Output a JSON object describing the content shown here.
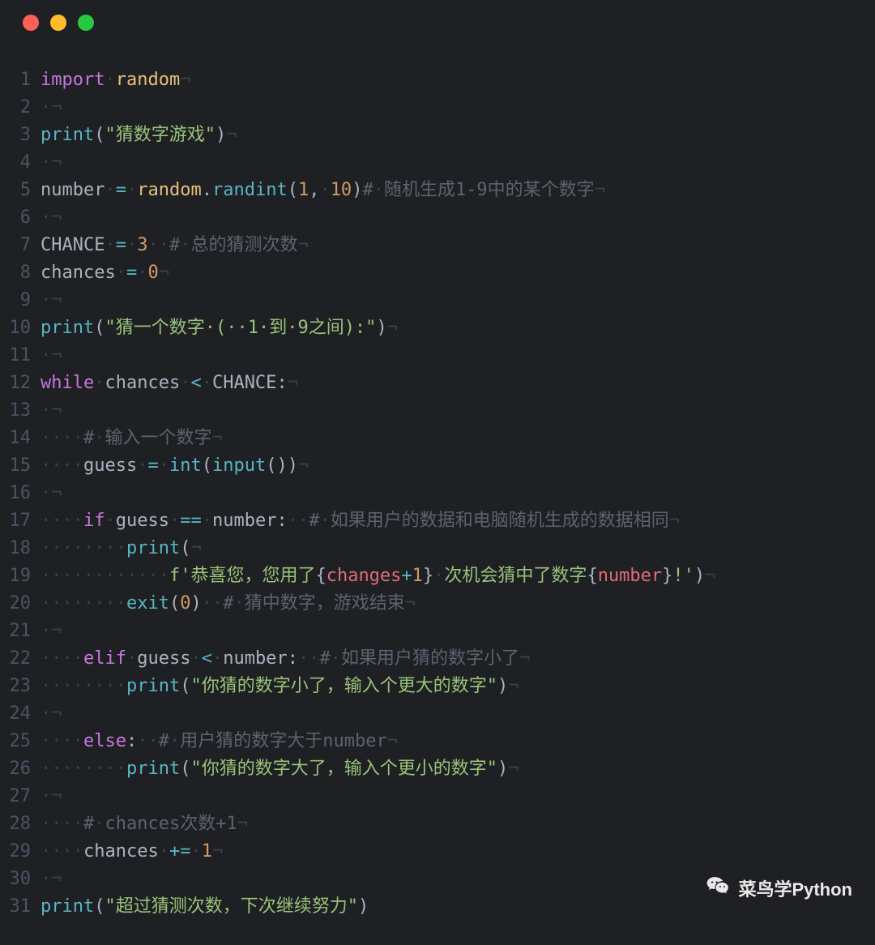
{
  "window": {
    "traffic": [
      "red",
      "yellow",
      "green"
    ]
  },
  "editor": {
    "invisibles": {
      "dot": "·",
      "eol": "¬"
    },
    "lines": [
      {
        "n": 1,
        "tokens": [
          {
            "t": "import",
            "c": "kw"
          },
          {
            "t": "·",
            "c": "ws"
          },
          {
            "t": "random",
            "c": "id"
          },
          {
            "t": "¬",
            "c": "ws"
          }
        ]
      },
      {
        "n": 2,
        "tokens": [
          {
            "t": "·",
            "c": "ws"
          },
          {
            "t": "¬",
            "c": "ws"
          }
        ]
      },
      {
        "n": 3,
        "tokens": [
          {
            "t": "print",
            "c": "fn"
          },
          {
            "t": "(",
            "c": "pn"
          },
          {
            "t": "\"猜数字游戏\"",
            "c": "str"
          },
          {
            "t": ")",
            "c": "pn"
          },
          {
            "t": "¬",
            "c": "ws"
          }
        ]
      },
      {
        "n": 4,
        "tokens": [
          {
            "t": "·",
            "c": "ws"
          },
          {
            "t": "¬",
            "c": "ws"
          }
        ]
      },
      {
        "n": 5,
        "tokens": [
          {
            "t": "number",
            "c": "var"
          },
          {
            "t": "·",
            "c": "ws"
          },
          {
            "t": "=",
            "c": "op"
          },
          {
            "t": "·",
            "c": "ws"
          },
          {
            "t": "random",
            "c": "id"
          },
          {
            "t": ".",
            "c": "pn"
          },
          {
            "t": "randint",
            "c": "fn"
          },
          {
            "t": "(",
            "c": "pn"
          },
          {
            "t": "1",
            "c": "num"
          },
          {
            "t": ",",
            "c": "pn"
          },
          {
            "t": "·",
            "c": "ws"
          },
          {
            "t": "10",
            "c": "num"
          },
          {
            "t": ")",
            "c": "pn"
          },
          {
            "t": "#",
            "c": "cmt"
          },
          {
            "t": "·",
            "c": "ws"
          },
          {
            "t": "随机生成1-9中的某个数字",
            "c": "cmt"
          },
          {
            "t": "¬",
            "c": "ws"
          }
        ]
      },
      {
        "n": 6,
        "tokens": [
          {
            "t": "·",
            "c": "ws"
          },
          {
            "t": "¬",
            "c": "ws"
          }
        ]
      },
      {
        "n": 7,
        "tokens": [
          {
            "t": "CHANCE",
            "c": "var"
          },
          {
            "t": "·",
            "c": "ws"
          },
          {
            "t": "=",
            "c": "op"
          },
          {
            "t": "·",
            "c": "ws"
          },
          {
            "t": "3",
            "c": "num"
          },
          {
            "t": "··",
            "c": "ws"
          },
          {
            "t": "#",
            "c": "cmt"
          },
          {
            "t": "·",
            "c": "ws"
          },
          {
            "t": "总的猜测次数",
            "c": "cmt"
          },
          {
            "t": "¬",
            "c": "ws"
          }
        ]
      },
      {
        "n": 8,
        "tokens": [
          {
            "t": "chances",
            "c": "var"
          },
          {
            "t": "·",
            "c": "ws"
          },
          {
            "t": "=",
            "c": "op"
          },
          {
            "t": "·",
            "c": "ws"
          },
          {
            "t": "0",
            "c": "num"
          },
          {
            "t": "¬",
            "c": "ws"
          }
        ]
      },
      {
        "n": 9,
        "tokens": [
          {
            "t": "·",
            "c": "ws"
          },
          {
            "t": "¬",
            "c": "ws"
          }
        ]
      },
      {
        "n": 10,
        "tokens": [
          {
            "t": "print",
            "c": "fn"
          },
          {
            "t": "(",
            "c": "pn"
          },
          {
            "t": "\"猜一个数字·(··1·到·9之间):\"",
            "c": "str"
          },
          {
            "t": ")",
            "c": "pn"
          },
          {
            "t": "¬",
            "c": "ws"
          }
        ]
      },
      {
        "n": 11,
        "tokens": [
          {
            "t": "·",
            "c": "ws"
          },
          {
            "t": "¬",
            "c": "ws"
          }
        ]
      },
      {
        "n": 12,
        "tokens": [
          {
            "t": "while",
            "c": "kw"
          },
          {
            "t": "·",
            "c": "ws"
          },
          {
            "t": "chances",
            "c": "var"
          },
          {
            "t": "·",
            "c": "ws"
          },
          {
            "t": "<",
            "c": "op"
          },
          {
            "t": "·",
            "c": "ws"
          },
          {
            "t": "CHANCE",
            "c": "var"
          },
          {
            "t": ":",
            "c": "pn"
          },
          {
            "t": "¬",
            "c": "ws"
          }
        ]
      },
      {
        "n": 13,
        "tokens": [
          {
            "t": "·",
            "c": "ws"
          },
          {
            "t": "¬",
            "c": "ws"
          }
        ]
      },
      {
        "n": 14,
        "tokens": [
          {
            "t": "····",
            "c": "ws"
          },
          {
            "t": "#",
            "c": "cmt"
          },
          {
            "t": "·",
            "c": "ws"
          },
          {
            "t": "输入一个数字",
            "c": "cmt"
          },
          {
            "t": "¬",
            "c": "ws"
          }
        ]
      },
      {
        "n": 15,
        "tokens": [
          {
            "t": "····",
            "c": "ws"
          },
          {
            "t": "guess",
            "c": "var"
          },
          {
            "t": "·",
            "c": "ws"
          },
          {
            "t": "=",
            "c": "op"
          },
          {
            "t": "·",
            "c": "ws"
          },
          {
            "t": "int",
            "c": "fn"
          },
          {
            "t": "(",
            "c": "pn"
          },
          {
            "t": "input",
            "c": "fn"
          },
          {
            "t": "(",
            "c": "pn"
          },
          {
            "t": ")",
            "c": "pn"
          },
          {
            "t": ")",
            "c": "pn"
          },
          {
            "t": "¬",
            "c": "ws"
          }
        ]
      },
      {
        "n": 16,
        "tokens": [
          {
            "t": "·",
            "c": "ws"
          },
          {
            "t": "¬",
            "c": "ws"
          }
        ]
      },
      {
        "n": 17,
        "tokens": [
          {
            "t": "····",
            "c": "ws"
          },
          {
            "t": "if",
            "c": "kw"
          },
          {
            "t": "·",
            "c": "ws"
          },
          {
            "t": "guess",
            "c": "var"
          },
          {
            "t": "·",
            "c": "ws"
          },
          {
            "t": "==",
            "c": "op"
          },
          {
            "t": "·",
            "c": "ws"
          },
          {
            "t": "number",
            "c": "var"
          },
          {
            "t": ":",
            "c": "pn"
          },
          {
            "t": "··",
            "c": "ws"
          },
          {
            "t": "#",
            "c": "cmt"
          },
          {
            "t": "·",
            "c": "ws"
          },
          {
            "t": "如果用户的数据和电脑随机生成的数据相同",
            "c": "cmt"
          },
          {
            "t": "¬",
            "c": "ws"
          }
        ]
      },
      {
        "n": 18,
        "tokens": [
          {
            "t": "········",
            "c": "ws"
          },
          {
            "t": "print",
            "c": "fn"
          },
          {
            "t": "(",
            "c": "pn"
          },
          {
            "t": "¬",
            "c": "ws"
          }
        ]
      },
      {
        "n": 19,
        "tokens": [
          {
            "t": "············",
            "c": "ws"
          },
          {
            "t": "f'恭喜您，您用了",
            "c": "str"
          },
          {
            "t": "{",
            "c": "pn"
          },
          {
            "t": "changes",
            "c": "fvar"
          },
          {
            "t": "+",
            "c": "op"
          },
          {
            "t": "1",
            "c": "num"
          },
          {
            "t": "}",
            "c": "pn"
          },
          {
            "t": "·",
            "c": "ws"
          },
          {
            "t": "次机会猜中了数字",
            "c": "str"
          },
          {
            "t": "{",
            "c": "pn"
          },
          {
            "t": "number",
            "c": "fvar"
          },
          {
            "t": "}",
            "c": "pn"
          },
          {
            "t": "!'",
            "c": "str"
          },
          {
            "t": ")",
            "c": "pn"
          },
          {
            "t": "¬",
            "c": "ws"
          }
        ]
      },
      {
        "n": 20,
        "tokens": [
          {
            "t": "········",
            "c": "ws"
          },
          {
            "t": "exit",
            "c": "fn"
          },
          {
            "t": "(",
            "c": "pn"
          },
          {
            "t": "0",
            "c": "num"
          },
          {
            "t": ")",
            "c": "pn"
          },
          {
            "t": "··",
            "c": "ws"
          },
          {
            "t": "#",
            "c": "cmt"
          },
          {
            "t": "·",
            "c": "ws"
          },
          {
            "t": "猜中数字，游戏结束",
            "c": "cmt"
          },
          {
            "t": "¬",
            "c": "ws"
          }
        ]
      },
      {
        "n": 21,
        "tokens": [
          {
            "t": "·",
            "c": "ws"
          },
          {
            "t": "¬",
            "c": "ws"
          }
        ]
      },
      {
        "n": 22,
        "tokens": [
          {
            "t": "····",
            "c": "ws"
          },
          {
            "t": "elif",
            "c": "kw"
          },
          {
            "t": "·",
            "c": "ws"
          },
          {
            "t": "guess",
            "c": "var"
          },
          {
            "t": "·",
            "c": "ws"
          },
          {
            "t": "<",
            "c": "op"
          },
          {
            "t": "·",
            "c": "ws"
          },
          {
            "t": "number",
            "c": "var"
          },
          {
            "t": ":",
            "c": "pn"
          },
          {
            "t": "··",
            "c": "ws"
          },
          {
            "t": "#",
            "c": "cmt"
          },
          {
            "t": "·",
            "c": "ws"
          },
          {
            "t": "如果用户猜的数字小了",
            "c": "cmt"
          },
          {
            "t": "¬",
            "c": "ws"
          }
        ]
      },
      {
        "n": 23,
        "tokens": [
          {
            "t": "········",
            "c": "ws"
          },
          {
            "t": "print",
            "c": "fn"
          },
          {
            "t": "(",
            "c": "pn"
          },
          {
            "t": "\"你猜的数字小了，输入个更大的数字\"",
            "c": "str"
          },
          {
            "t": ")",
            "c": "pn"
          },
          {
            "t": "¬",
            "c": "ws"
          }
        ]
      },
      {
        "n": 24,
        "tokens": [
          {
            "t": "·",
            "c": "ws"
          },
          {
            "t": "¬",
            "c": "ws"
          }
        ]
      },
      {
        "n": 25,
        "tokens": [
          {
            "t": "····",
            "c": "ws"
          },
          {
            "t": "else",
            "c": "kw"
          },
          {
            "t": ":",
            "c": "pn"
          },
          {
            "t": "··",
            "c": "ws"
          },
          {
            "t": "#",
            "c": "cmt"
          },
          {
            "t": "·",
            "c": "ws"
          },
          {
            "t": "用户猜的数字大于number",
            "c": "cmt"
          },
          {
            "t": "¬",
            "c": "ws"
          }
        ]
      },
      {
        "n": 26,
        "tokens": [
          {
            "t": "········",
            "c": "ws"
          },
          {
            "t": "print",
            "c": "fn"
          },
          {
            "t": "(",
            "c": "pn"
          },
          {
            "t": "\"你猜的数字大了，输入个更小的数字\"",
            "c": "str"
          },
          {
            "t": ")",
            "c": "pn"
          },
          {
            "t": "¬",
            "c": "ws"
          }
        ]
      },
      {
        "n": 27,
        "tokens": [
          {
            "t": "·",
            "c": "ws"
          },
          {
            "t": "¬",
            "c": "ws"
          }
        ]
      },
      {
        "n": 28,
        "tokens": [
          {
            "t": "····",
            "c": "ws"
          },
          {
            "t": "#",
            "c": "cmt"
          },
          {
            "t": "·",
            "c": "ws"
          },
          {
            "t": "chances次数+1",
            "c": "cmt"
          },
          {
            "t": "¬",
            "c": "ws"
          }
        ]
      },
      {
        "n": 29,
        "tokens": [
          {
            "t": "····",
            "c": "ws"
          },
          {
            "t": "chances",
            "c": "var"
          },
          {
            "t": "·",
            "c": "ws"
          },
          {
            "t": "+=",
            "c": "op"
          },
          {
            "t": "·",
            "c": "ws"
          },
          {
            "t": "1",
            "c": "num"
          },
          {
            "t": "¬",
            "c": "ws"
          }
        ]
      },
      {
        "n": 30,
        "tokens": [
          {
            "t": "·",
            "c": "ws"
          },
          {
            "t": "¬",
            "c": "ws"
          }
        ]
      },
      {
        "n": 31,
        "tokens": [
          {
            "t": "print",
            "c": "fn"
          },
          {
            "t": "(",
            "c": "pn"
          },
          {
            "t": "\"超过猜测次数，下次继续努力\"",
            "c": "str"
          },
          {
            "t": ")",
            "c": "pn"
          }
        ]
      }
    ]
  },
  "watermark": {
    "text": "菜鸟学Python",
    "icon": "wechat-icon"
  }
}
